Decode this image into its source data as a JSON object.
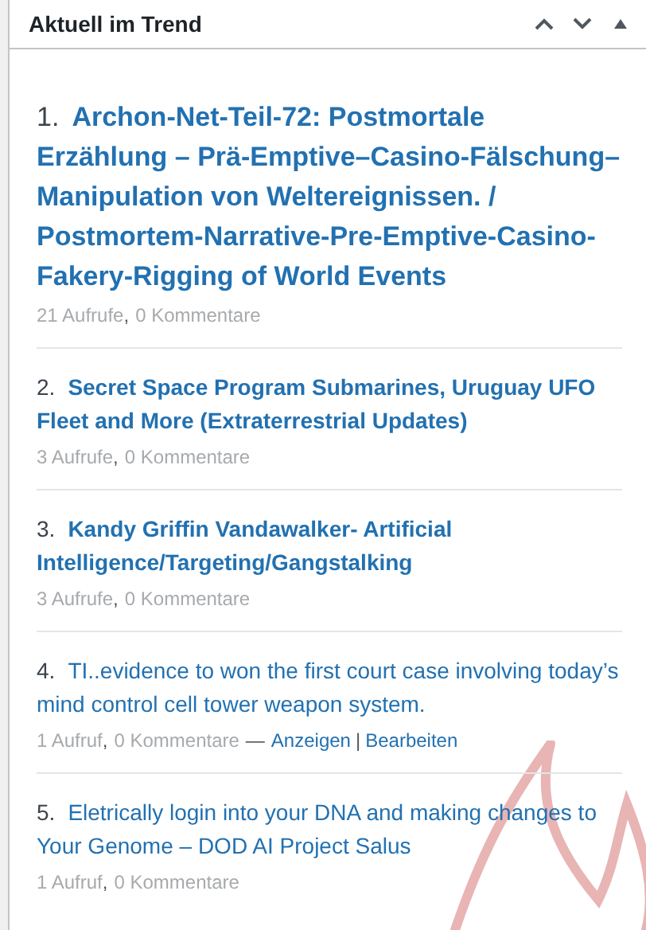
{
  "panel": {
    "title": "Aktuell im Trend"
  },
  "items": [
    {
      "number": "1.",
      "title": "Archon-Net-Teil-72: Postmortale Erzählung – Prä-Emptive–Casino-Fälschung– Manipulation von Weltereignissen. / Postmortem-Narrative-Pre-Emptive-Casino-Fakery-Rigging of World Events",
      "kind": "top",
      "views": "21 Aufrufe",
      "separator": ",",
      "comments": "0 Kommentare"
    },
    {
      "number": "2.",
      "title": "Secret Space Program Submarines, Uruguay UFO Fleet and More (Extraterrestrial Updates)",
      "kind": "featured",
      "views": "3 Aufrufe",
      "separator": ",",
      "comments": "0 Kommentare"
    },
    {
      "number": "3.",
      "title": "Kandy Griffin Vandawalker- Artificial Intelligence/Targeting/Gangstalking",
      "kind": "featured",
      "views": "3 Aufrufe",
      "separator": ",",
      "comments": "0 Kommentare"
    },
    {
      "number": "4.",
      "title": "TI..evidence to won the first court case involving today’s mind control cell tower weapon system.",
      "kind": "plain",
      "views": "1 Aufruf",
      "separator": ",",
      "comments": "0 Kommentare",
      "actions_prefix": "—",
      "actions": [
        "Anzeigen",
        "Bearbeiten"
      ],
      "actions_separator": "|"
    },
    {
      "number": "5.",
      "title": "Eletrically login into your DNA and making changes to Your Genome – DOD AI Project Salus",
      "kind": "plain",
      "views": "1 Aufruf",
      "separator": ",",
      "comments": "0 Kommentare"
    }
  ]
}
